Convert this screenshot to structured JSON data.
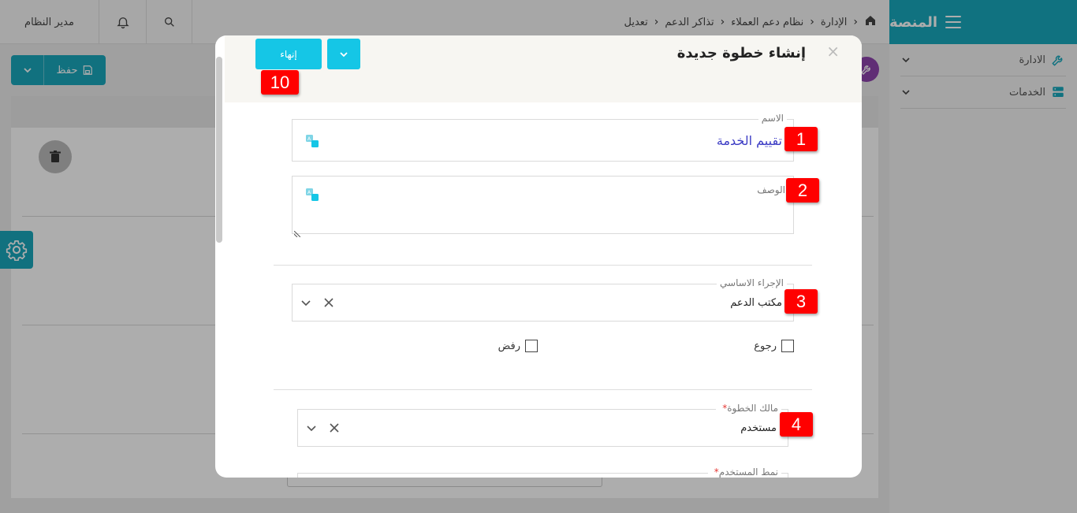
{
  "sidebar": {
    "brand": "المنصة",
    "items": [
      {
        "label": "الادارة"
      },
      {
        "label": "الخدمات"
      }
    ]
  },
  "topbar": {
    "breadcrumb": [
      "الإدارة",
      "نظام دعم العملاء",
      "تذاكر الدعم",
      "تعديل"
    ],
    "user": "مدير النظام"
  },
  "page": {
    "save_label": "حفظ"
  },
  "modal": {
    "title": "إنشاء خطوة جديدة",
    "finish_label": "إنهاء",
    "fields": {
      "name": {
        "label": "الاسم",
        "value": "تقييم الخدمة"
      },
      "description": {
        "label": "الوصف",
        "value": ""
      },
      "primary_action": {
        "label": "الإجراء الاساسي",
        "value": "مكتب الدعم"
      },
      "step_owner": {
        "label": "مالك الخطوة",
        "value": "مستخدم",
        "required": "*"
      },
      "user_type": {
        "label": "نمط المستخدم",
        "required": "*"
      }
    },
    "checkboxes": {
      "return": "رجوع",
      "reject": "رفض"
    }
  },
  "annotations": {
    "b1": "1",
    "b2": "2",
    "b3": "3",
    "b4": "4",
    "b10": "10"
  },
  "colors": {
    "accent": "#19a9bd",
    "button": "#15c6e6",
    "badge": "#ff0000",
    "name_value": "#3b3bc4"
  }
}
